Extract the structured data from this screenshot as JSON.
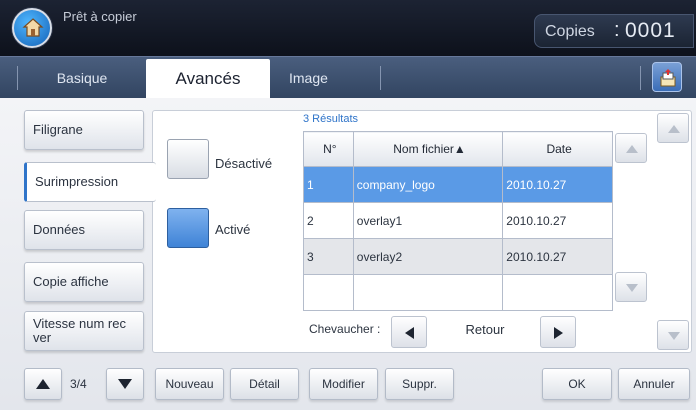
{
  "header": {
    "status": "Prêt à copier",
    "copies_label": "Copies",
    "copies_separator": ":",
    "copies_value": "0001",
    "home_icon": "home-icon"
  },
  "tabs": [
    {
      "label": "Basique",
      "active": false
    },
    {
      "label": "Avancés",
      "active": true
    },
    {
      "label": "Image",
      "active": false
    }
  ],
  "side_menu": [
    {
      "label": "Filigrane",
      "selected": false
    },
    {
      "label": "Surimpression",
      "selected": true
    },
    {
      "label": "Données",
      "selected": false
    },
    {
      "label": "Copie affiche",
      "selected": false
    },
    {
      "label": "Vitesse num rec ver",
      "selected": false
    }
  ],
  "options": {
    "off_label": "Désactivé",
    "on_label": "Activé",
    "selected": "on"
  },
  "file_list": {
    "results": "3 Résultats",
    "headers": {
      "num": "N°",
      "name": "Nom fichier▲",
      "date": "Date"
    },
    "rows": [
      {
        "num": "1",
        "name": "company_logo",
        "date": "2010.10.27",
        "selected": true
      },
      {
        "num": "2",
        "name": "overlay1",
        "date": "2010.10.27",
        "selected": false
      },
      {
        "num": "3",
        "name": "overlay2",
        "date": "2010.10.27",
        "selected": false
      }
    ]
  },
  "overlap": {
    "label": "Chevaucher :",
    "value": "Retour"
  },
  "footer": {
    "page": "3/4",
    "buttons": {
      "new": "Nouveau",
      "detail": "Détail",
      "modify": "Modifier",
      "delete": "Suppr.",
      "ok": "OK",
      "cancel": "Annuler"
    }
  },
  "colors": {
    "accent": "#3f83d6",
    "selected_row": "#5a9ae6",
    "header_bg": "#1c2333",
    "tab_bar": "#405473"
  }
}
